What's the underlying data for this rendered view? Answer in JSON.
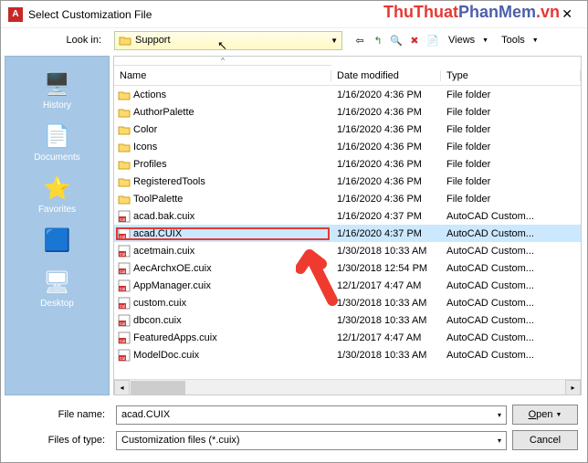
{
  "window": {
    "title": "Select Customization File"
  },
  "toolbar": {
    "lookin_label": "Look in:",
    "lookin_value": "Support",
    "views": "Views",
    "tools": "Tools"
  },
  "sidebar": [
    {
      "label": "History",
      "icon": "history"
    },
    {
      "label": "Documents",
      "icon": "doc"
    },
    {
      "label": "Favorites",
      "icon": "star"
    },
    {
      "label": "",
      "icon": "ftp"
    },
    {
      "label": "Desktop",
      "icon": "desktop"
    }
  ],
  "columns": {
    "name": "Name",
    "date": "Date modified",
    "type": "Type"
  },
  "files": [
    {
      "name": "Actions",
      "date": "1/16/2020 4:36 PM",
      "type": "File folder",
      "kind": "folder"
    },
    {
      "name": "AuthorPalette",
      "date": "1/16/2020 4:36 PM",
      "type": "File folder",
      "kind": "folder"
    },
    {
      "name": "Color",
      "date": "1/16/2020 4:36 PM",
      "type": "File folder",
      "kind": "folder"
    },
    {
      "name": "Icons",
      "date": "1/16/2020 4:36 PM",
      "type": "File folder",
      "kind": "folder"
    },
    {
      "name": "Profiles",
      "date": "1/16/2020 4:36 PM",
      "type": "File folder",
      "kind": "folder"
    },
    {
      "name": "RegisteredTools",
      "date": "1/16/2020 4:36 PM",
      "type": "File folder",
      "kind": "folder"
    },
    {
      "name": "ToolPalette",
      "date": "1/16/2020 4:36 PM",
      "type": "File folder",
      "kind": "folder"
    },
    {
      "name": "acad.bak.cuix",
      "date": "1/16/2020 4:37 PM",
      "type": "AutoCAD Custom...",
      "kind": "cuix"
    },
    {
      "name": "acad.CUIX",
      "date": "1/16/2020 4:37 PM",
      "type": "AutoCAD Custom...",
      "kind": "cuix",
      "selected": true
    },
    {
      "name": "acetmain.cuix",
      "date": "1/30/2018 10:33 AM",
      "type": "AutoCAD Custom...",
      "kind": "cuix"
    },
    {
      "name": "AecArchxOE.cuix",
      "date": "1/30/2018 12:54 PM",
      "type": "AutoCAD Custom...",
      "kind": "cuix"
    },
    {
      "name": "AppManager.cuix",
      "date": "12/1/2017 4:47 AM",
      "type": "AutoCAD Custom...",
      "kind": "cuix"
    },
    {
      "name": "custom.cuix",
      "date": "1/30/2018 10:33 AM",
      "type": "AutoCAD Custom...",
      "kind": "cuix"
    },
    {
      "name": "dbcon.cuix",
      "date": "1/30/2018 10:33 AM",
      "type": "AutoCAD Custom...",
      "kind": "cuix"
    },
    {
      "name": "FeaturedApps.cuix",
      "date": "12/1/2017 4:47 AM",
      "type": "AutoCAD Custom...",
      "kind": "cuix"
    },
    {
      "name": "ModelDoc.cuix",
      "date": "1/30/2018 10:33 AM",
      "type": "AutoCAD Custom...",
      "kind": "cuix"
    }
  ],
  "bottom": {
    "file_name_label": "File name:",
    "file_name_value": "acad.CUIX",
    "type_label": "Files of type:",
    "type_value": "Customization files (*.cuix)",
    "open": "Open",
    "cancel": "Cancel"
  },
  "watermark": {
    "t1": "ThuThuat",
    "t2": "PhanMem",
    "t3": ".vn"
  }
}
